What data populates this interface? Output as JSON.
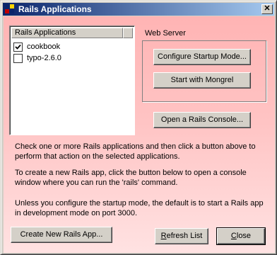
{
  "window": {
    "title": "Rails Applications",
    "close_glyph": "✕"
  },
  "app_list": {
    "header": "Rails Applications",
    "items": [
      {
        "label": "cookbook",
        "checked": true
      },
      {
        "label": "typo-2.6.0",
        "checked": false
      }
    ]
  },
  "web_server": {
    "label": "Web Server",
    "configure_button": "Configure Startup Mode...",
    "start_button": "Start with Mongrel"
  },
  "console_button": "Open a Rails Console...",
  "instructions": [
    "Check one or more Rails applications and then click a button above to perform that action on the selected applications.",
    "To create a new Rails app, click the button below to open a console window where you can run the 'rails' command.",
    "Unless you configure the startup mode, the default is to start a Rails app in development mode on port 3000."
  ],
  "footer": {
    "create_button": "Create New Rails App...",
    "refresh_button_first": "R",
    "refresh_button_rest": "efresh List",
    "close_button_first": "C",
    "close_button_rest": "lose"
  }
}
